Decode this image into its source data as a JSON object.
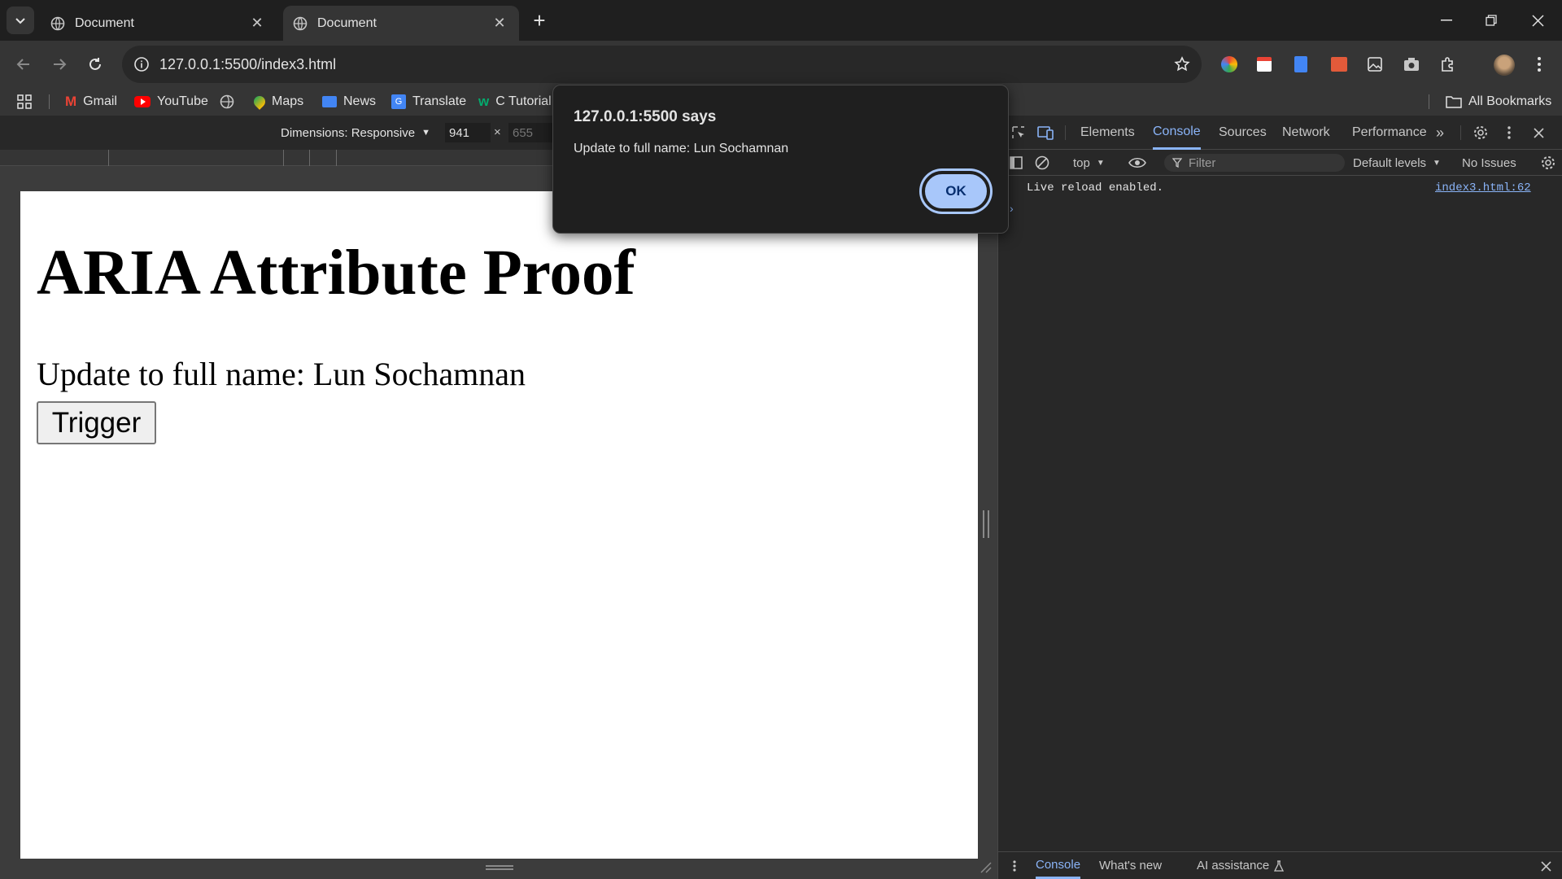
{
  "browser": {
    "tabs": [
      {
        "title": "Document",
        "active": false
      },
      {
        "title": "Document",
        "active": true
      }
    ],
    "url": "127.0.0.1:5500/index3.html"
  },
  "bookmarks": {
    "items": [
      "Gmail",
      "YouTube",
      "Maps",
      "News",
      "Translate",
      "C Tutorial"
    ],
    "all_bookmarks": "All Bookmarks"
  },
  "emulation": {
    "dimensions_label": "Dimensions: Responsive",
    "width": "941",
    "height": "655",
    "times": "×"
  },
  "page": {
    "heading": "ARIA Attribute Proof",
    "message": "Update to full name: Lun Sochamnan",
    "button_label": "Trigger"
  },
  "dialog": {
    "title": "127.0.0.1:5500 says",
    "message": "Update to full name: Lun Sochamnan",
    "ok_label": "OK"
  },
  "devtools": {
    "tabs": [
      "Elements",
      "Console",
      "Sources",
      "Network",
      "Performance"
    ],
    "active_tab": "Console",
    "context": "top",
    "filter_placeholder": "Filter",
    "levels": "Default levels",
    "issues": "No Issues",
    "log": {
      "text": "Live reload enabled.",
      "source": "index3.html:62"
    },
    "drawer_tabs": [
      "Console",
      "What's new",
      "AI assistance"
    ]
  },
  "colors": {
    "accent": "#a8c7fa",
    "link": "#8ab4f8",
    "page_bg": "#ffffff"
  }
}
